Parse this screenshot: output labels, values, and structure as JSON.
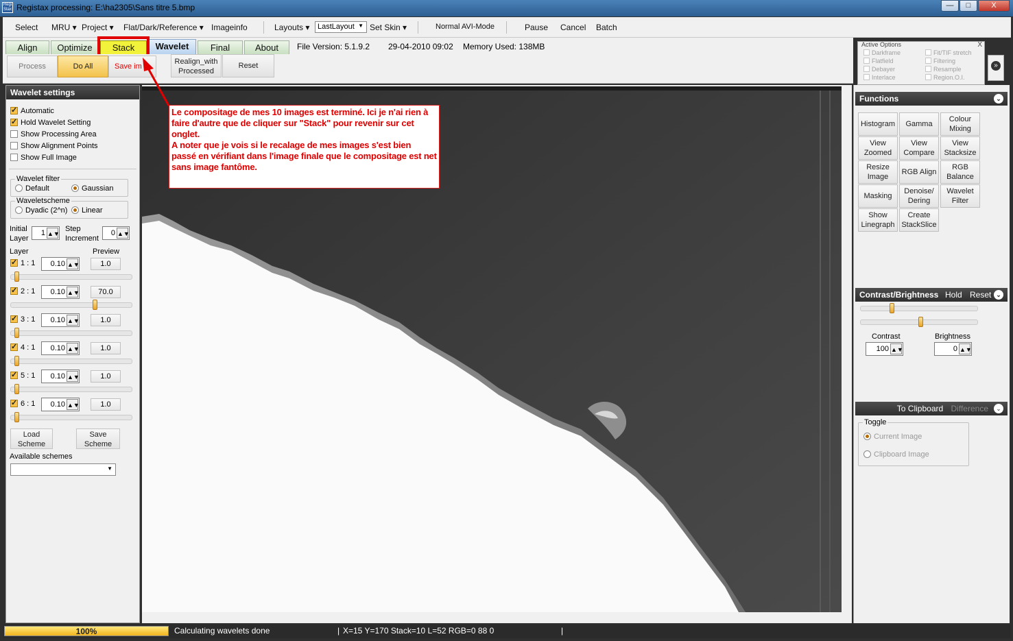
{
  "window": {
    "title": "Registax processing: E:\\ha2305\\Sans titre 5.bmp",
    "app_icon_text": "Regi Stax",
    "minimize": "—",
    "maximize": "□",
    "close": "X"
  },
  "menu": {
    "select": "Select",
    "mru": "MRU ▾",
    "project": "Project ▾",
    "flat": "Flat/Dark/Reference ▾",
    "imageinfo": "Imageinfo",
    "layouts": "Layouts ▾",
    "layout_value": "LastLayout",
    "setskin": "Set Skin ▾",
    "normal_avi": "Normal AVI-Mode",
    "pause": "Pause",
    "cancel": "Cancel",
    "batch": "Batch"
  },
  "tabs": {
    "align": "Align",
    "optimize": "Optimize",
    "stack": "Stack",
    "wavelet": "Wavelet",
    "final": "Final",
    "about": "About"
  },
  "info": {
    "file_version": "File Version: 5.1.9.2",
    "date": "29-04-2010 09:02",
    "memory": "Memory Used: 138MB"
  },
  "toolbar": {
    "process": "Process",
    "do_all": "Do All",
    "save_image": "Save im",
    "realign": "Realign_with Processed",
    "reset": "Reset"
  },
  "active_options": {
    "title": "Active Options",
    "close": "X",
    "items_left": [
      "Darkframe",
      "Flatfield",
      "Debayer",
      "Interlace"
    ],
    "items_right": [
      "Fit/TIF stretch",
      "Filtering",
      "Resample",
      "Region.O.I."
    ],
    "expand": "»"
  },
  "wavelet_settings": {
    "title": "Wavelet settings",
    "automatic": "Automatic",
    "hold": "Hold Wavelet Setting",
    "show_area": "Show Processing Area",
    "show_points": "Show Alignment Points",
    "show_full": "Show Full Image",
    "filter_label": "Wavelet filter",
    "filter_default": "Default",
    "filter_gaussian": "Gaussian",
    "scheme_label": "Waveletscheme",
    "scheme_dyadic": "Dyadic (2^n)",
    "scheme_linear": "Linear",
    "initial_layer": "Initial Layer",
    "initial_layer_value": "1",
    "step_increment": "Step Increment",
    "step_value": "0",
    "layer_header": "Layer",
    "preview_header": "Preview",
    "layers": [
      {
        "label": "1 : 1",
        "value": "0.10",
        "preview": "1.0",
        "level": 0.03
      },
      {
        "label": "2 : 1",
        "value": "0.10",
        "preview": "70.0",
        "level": 0.7
      },
      {
        "label": "3 : 1",
        "value": "0.10",
        "preview": "1.0",
        "level": 0.03
      },
      {
        "label": "4 : 1",
        "value": "0.10",
        "preview": "1.0",
        "level": 0.03
      },
      {
        "label": "5 : 1",
        "value": "0.10",
        "preview": "1.0",
        "level": 0.03
      },
      {
        "label": "6 : 1",
        "value": "0.10",
        "preview": "1.0",
        "level": 0.03
      }
    ],
    "load_scheme": "Load Scheme",
    "save_scheme": "Save Scheme",
    "available_schemes": "Available schemes"
  },
  "annotation": {
    "line1": "Le compositage de mes 10 images est terminé. Ici je n'ai rien à faire d'autre que de cliquer sur \"Stack\" pour revenir sur cet onglet.",
    "line2": "A noter que je vois si le recalage de mes images s'est bien passé en vérifiant dans l'image finale que le compositage est net sans image fantôme."
  },
  "functions": {
    "title": "Functions",
    "buttons": [
      "Histogram",
      "Gamma",
      "Colour Mixing",
      "View Zoomed",
      "View Compare",
      "View Stacksize",
      "Resize Image",
      "RGB Align",
      "RGB Balance",
      "Masking",
      "Denoise/ Dering",
      "Wavelet Filter",
      "Show Linegraph",
      "Create StackSlice"
    ]
  },
  "contrast": {
    "title": "Contrast/Brightness",
    "hold": "Hold",
    "reset": "Reset",
    "contrast_label": "Contrast",
    "contrast_value": "100",
    "brightness_label": "Brightness",
    "brightness_value": "0"
  },
  "clipboard": {
    "to_clipboard": "To Clipboard",
    "difference": "Difference",
    "toggle": "Toggle",
    "current": "Current Image",
    "clipboard_image": "Clipboard Image"
  },
  "status": {
    "progress": "100%",
    "progress_fraction": 1.0,
    "message": "Calculating wavelets done",
    "coords": "X=15 Y=170 Stack=10 L=52 RGB=0 88 0"
  }
}
